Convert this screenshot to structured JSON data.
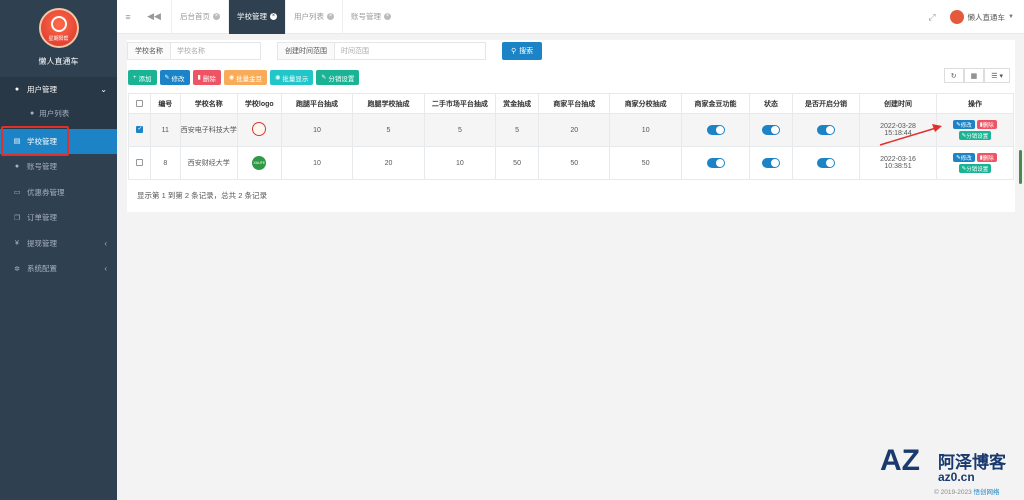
{
  "app": {
    "name": "懒人直通车",
    "logo_text": "星期阳帮"
  },
  "sidebar": {
    "items": [
      {
        "label": "用户管理",
        "icon": "user-icon",
        "state": "open"
      },
      {
        "label": "用户列表",
        "icon": "user-icon",
        "state": "sub"
      },
      {
        "label": "学校管理",
        "icon": "school-icon",
        "state": "active"
      },
      {
        "label": "账号管理",
        "icon": "users-icon",
        "state": "normal"
      },
      {
        "label": "优惠券管理",
        "icon": "coupon-icon",
        "state": "normal"
      },
      {
        "label": "订单管理",
        "icon": "order-icon",
        "state": "normal"
      },
      {
        "label": "提现管理",
        "icon": "yen-icon",
        "state": "collapsed"
      },
      {
        "label": "系统配置",
        "icon": "gear-icon",
        "state": "collapsed"
      }
    ]
  },
  "topbar": {
    "tabs": [
      {
        "label": "后台首页",
        "active": false
      },
      {
        "label": "学校管理",
        "active": true
      },
      {
        "label": "用户列表",
        "active": false
      },
      {
        "label": "账号管理",
        "active": false
      }
    ],
    "user": "懒人直通车"
  },
  "search": {
    "school_label": "学校名称",
    "school_placeholder": "学校名称",
    "time_label": "创建时间范围",
    "time_placeholder": "时间范围",
    "button": "搜索"
  },
  "toolbar": {
    "add": "添加",
    "edit": "修改",
    "delete": "删除",
    "beans": "批量金豆",
    "batch_show": "批量显示",
    "distribution": "分销设置"
  },
  "table": {
    "headers": [
      "编号",
      "学校名称",
      "学校logo",
      "跑腿平台抽成",
      "跑腿学校抽成",
      "二手市场平台抽成",
      "赏金抽成",
      "商家平台抽成",
      "商家分校抽成",
      "商家金豆功能",
      "状态",
      "是否开启分销",
      "创建时间",
      "操作"
    ],
    "rows": [
      {
        "checked": true,
        "id": "11",
        "name": "西安电子科技大学",
        "logo": "red",
        "c1": "10",
        "c2": "5",
        "c3": "5",
        "c4": "5",
        "c5": "20",
        "c6": "10",
        "beans": true,
        "status": true,
        "dist": true,
        "date": "2022-03-28",
        "time": "15:18:44"
      },
      {
        "checked": false,
        "id": "8",
        "name": "西安财经大学",
        "logo": "green",
        "c1": "10",
        "c2": "20",
        "c3": "10",
        "c4": "50",
        "c5": "50",
        "c6": "50",
        "beans": true,
        "status": true,
        "dist": true,
        "date": "2022-03-16",
        "time": "10:38:51"
      }
    ],
    "op_edit": "修改",
    "op_delete": "删除",
    "op_dist": "分销设置",
    "logo_green_text": "XAUFE"
  },
  "pager": "显示第 1 到第 2 条记录，总共 2 条记录",
  "watermark": {
    "az": "AZ",
    "name": "阿泽博客",
    "url": "az0.cn",
    "copyright": "© 2019-2023 ",
    "brand": "悟创网络"
  },
  "colors": {
    "sidebar": "#2f4050",
    "primary": "#1c84c6",
    "success": "#1ab394",
    "danger": "#ed5565",
    "warning": "#f8ac59",
    "info": "#23c6c8"
  }
}
